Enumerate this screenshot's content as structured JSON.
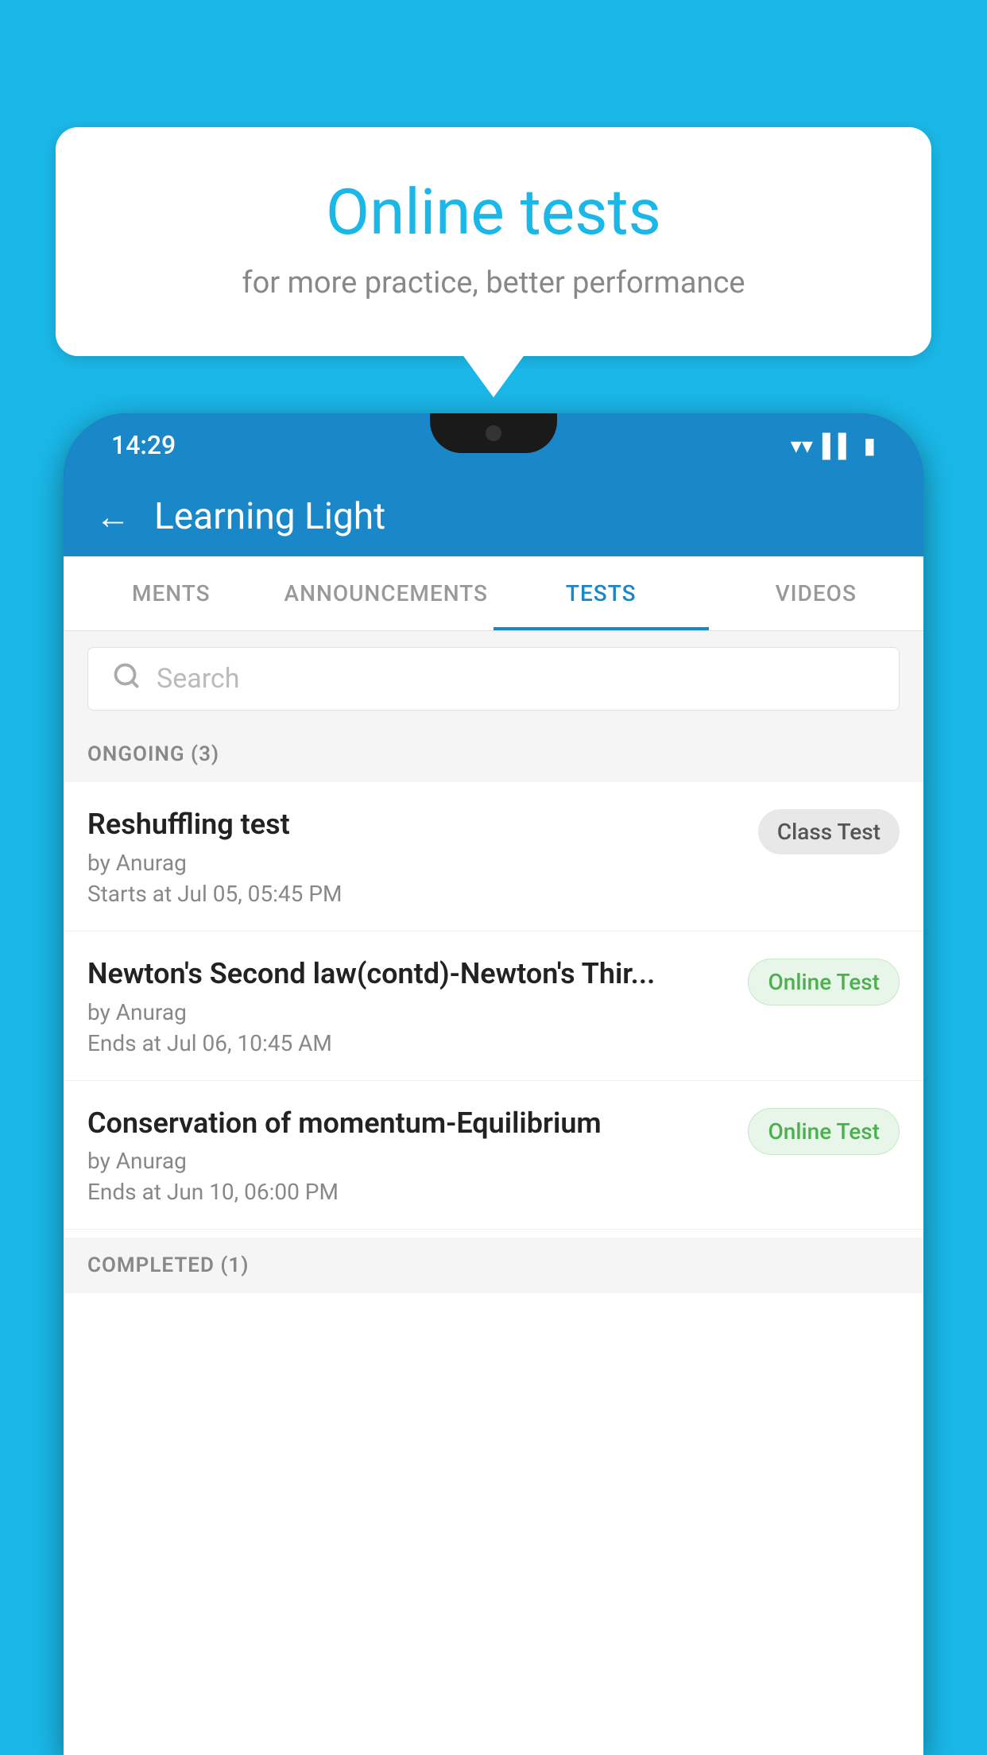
{
  "bubble": {
    "title": "Online tests",
    "subtitle": "for more practice, better performance"
  },
  "status_bar": {
    "time": "14:29",
    "icons": [
      "wifi",
      "signal",
      "battery"
    ]
  },
  "app_header": {
    "back_label": "←",
    "title": "Learning Light"
  },
  "tabs": [
    {
      "id": "ments",
      "label": "MENTS",
      "active": false
    },
    {
      "id": "announcements",
      "label": "ANNOUNCEMENTS",
      "active": false
    },
    {
      "id": "tests",
      "label": "TESTS",
      "active": true
    },
    {
      "id": "videos",
      "label": "VIDEOS",
      "active": false
    }
  ],
  "search": {
    "placeholder": "Search"
  },
  "ongoing_section": {
    "label": "ONGOING (3)"
  },
  "test_cards": [
    {
      "name": "Reshuffling test",
      "author": "by Anurag",
      "date": "Starts at  Jul 05, 05:45 PM",
      "badge": "Class Test",
      "badge_type": "class"
    },
    {
      "name": "Newton's Second law(contd)-Newton's Thir...",
      "author": "by Anurag",
      "date": "Ends at  Jul 06, 10:45 AM",
      "badge": "Online Test",
      "badge_type": "online"
    },
    {
      "name": "Conservation of momentum-Equilibrium",
      "author": "by Anurag",
      "date": "Ends at  Jun 10, 06:00 PM",
      "badge": "Online Test",
      "badge_type": "online"
    }
  ],
  "completed_section": {
    "label": "COMPLETED (1)"
  }
}
